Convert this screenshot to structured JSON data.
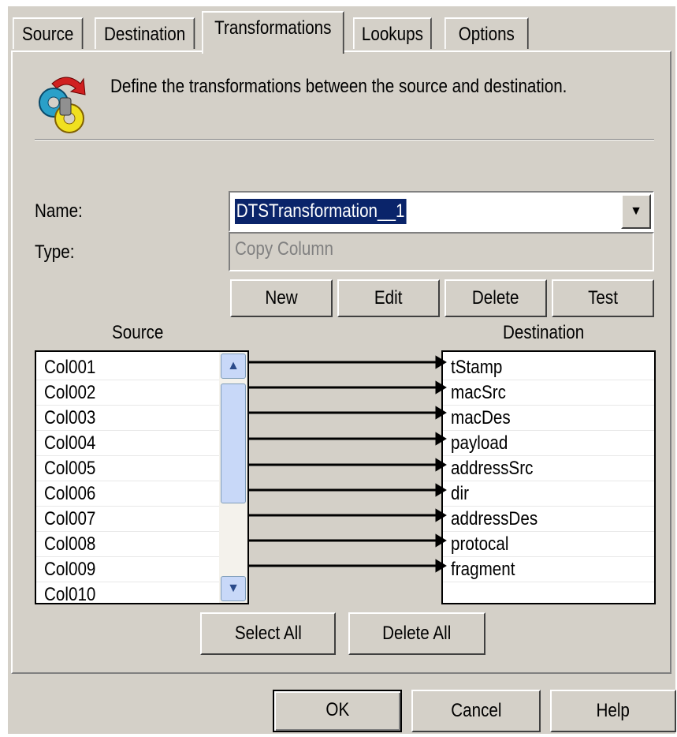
{
  "tabs": [
    {
      "label": "Source",
      "active": false
    },
    {
      "label": "Destination",
      "active": false
    },
    {
      "label": "Transformations",
      "active": true
    },
    {
      "label": "Lookups",
      "active": false
    },
    {
      "label": "Options",
      "active": false
    }
  ],
  "header": {
    "icon": "transform-gears-icon",
    "description": "Define the transformations between the source and destination."
  },
  "form": {
    "name_label": "Name:",
    "name_value": "DTSTransformation__1",
    "type_label": "Type:",
    "type_value": "Copy Column"
  },
  "buttons": {
    "new": "New",
    "edit": "Edit",
    "delete": "Delete",
    "test": "Test",
    "select_all": "Select All",
    "delete_all": "Delete All",
    "ok": "OK",
    "cancel": "Cancel",
    "help": "Help"
  },
  "source": {
    "label": "Source",
    "columns": [
      "Col001",
      "Col002",
      "Col003",
      "Col004",
      "Col005",
      "Col006",
      "Col007",
      "Col008",
      "Col009",
      "Col010"
    ]
  },
  "destination": {
    "label": "Destination",
    "columns": [
      "tStamp",
      "macSrc",
      "macDes",
      "payload",
      "addressSrc",
      "dir",
      "addressDes",
      "protocal",
      "fragment"
    ]
  },
  "colors": {
    "dialog_bg": "#d4d0c8",
    "selection": "#0a246a",
    "scrollbar": "#c8d8f8"
  }
}
